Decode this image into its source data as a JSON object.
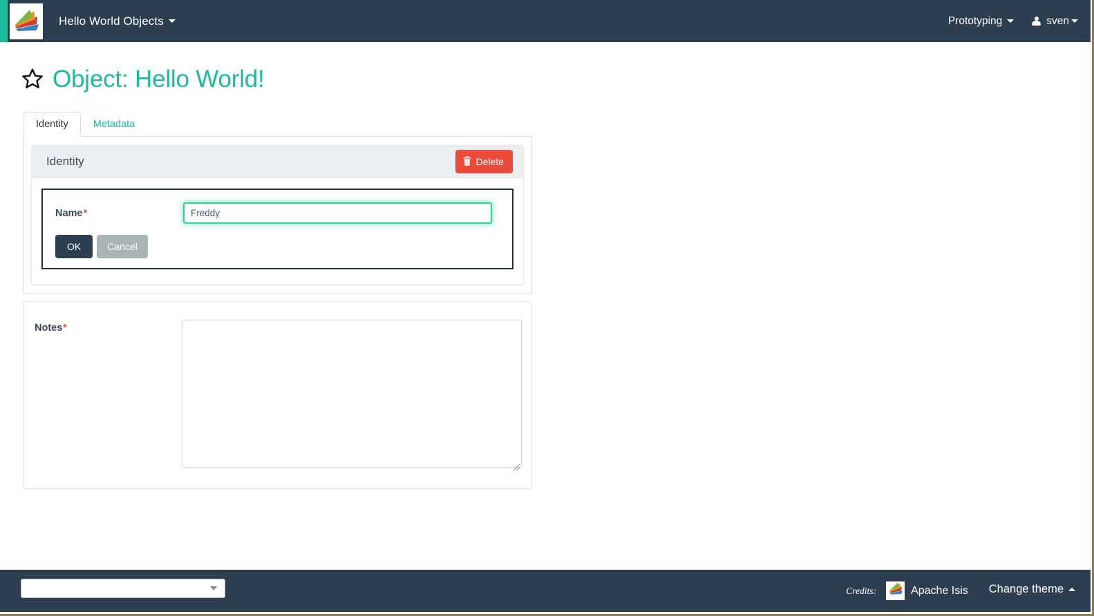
{
  "header": {
    "brand_label": "Hello World Objects",
    "brand_logo_icon": "apache-isis-fan-logo",
    "menu_prototyping": "Prototyping",
    "menu_user": "sven",
    "user_icon": "user-icon",
    "caret_icon": "caret-down-icon"
  },
  "title": {
    "star_icon": "star-outline-icon",
    "text": "Object: Hello World!"
  },
  "tabs": [
    {
      "label": "Identity",
      "active": true
    },
    {
      "label": "Metadata",
      "active": false
    }
  ],
  "identity_panel": {
    "header_title": "Identity",
    "delete_button": "Delete",
    "delete_icon": "trash-icon",
    "form": {
      "name_label": "Name",
      "required_marker": "*",
      "name_value": "Freddy",
      "name_placeholder": "",
      "ok_button": "OK",
      "cancel_button": "Cancel"
    }
  },
  "notes_panel": {
    "label": "Notes",
    "required_marker": "*",
    "value": "",
    "placeholder": "",
    "resize_handle_icon": "resize-grip-icon"
  },
  "footer": {
    "select_value": "",
    "select_placeholder": "",
    "select_arrow_icon": "caret-down-icon",
    "credits_label": "Credits:",
    "credit_logo_icon": "apache-isis-fan-logo",
    "credit_link": "Apache Isis",
    "change_theme": "Change theme",
    "change_theme_caret_icon": "caret-up-icon"
  },
  "colors": {
    "header_bg": "#2d3e50",
    "accent_teal": "#1abc9c",
    "title_green": "#1bbc9b",
    "delete_red": "#ec4a3b",
    "ok_navy": "#2d3e50",
    "cancel_gray": "#a8b5b4",
    "focus_green": "#2fd39e",
    "required_red": "#d9534f",
    "card_header_bg": "#eceff1"
  }
}
